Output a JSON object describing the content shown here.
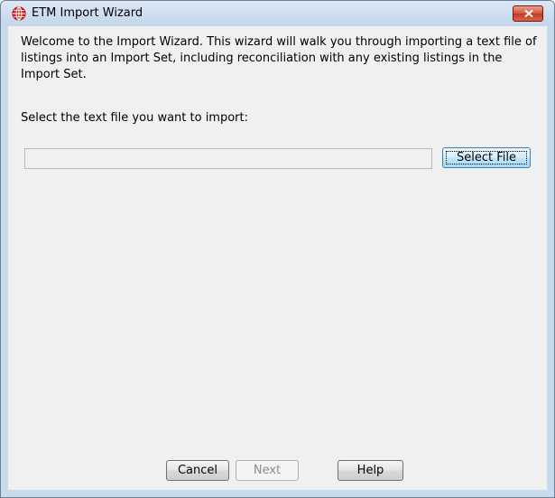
{
  "window": {
    "title": "ETM Import Wizard"
  },
  "intro_text": "Welcome to the Import Wizard.  This wizard will walk you through importing a text file of listings into an Import Set, including reconciliation with any existing listings in the Import Set.",
  "select_label": "Select the text file you want to import:",
  "file_input": {
    "value": "",
    "placeholder": ""
  },
  "buttons": {
    "select_file": "Select File",
    "cancel": "Cancel",
    "next": "Next",
    "help": "Help"
  },
  "icons": {
    "app": "etm-globe-icon",
    "close": "close-icon"
  },
  "colors": {
    "titlebar": "#c4d6ea",
    "close_button": "#c23a24",
    "dialog_background": "#f0f0f0"
  }
}
